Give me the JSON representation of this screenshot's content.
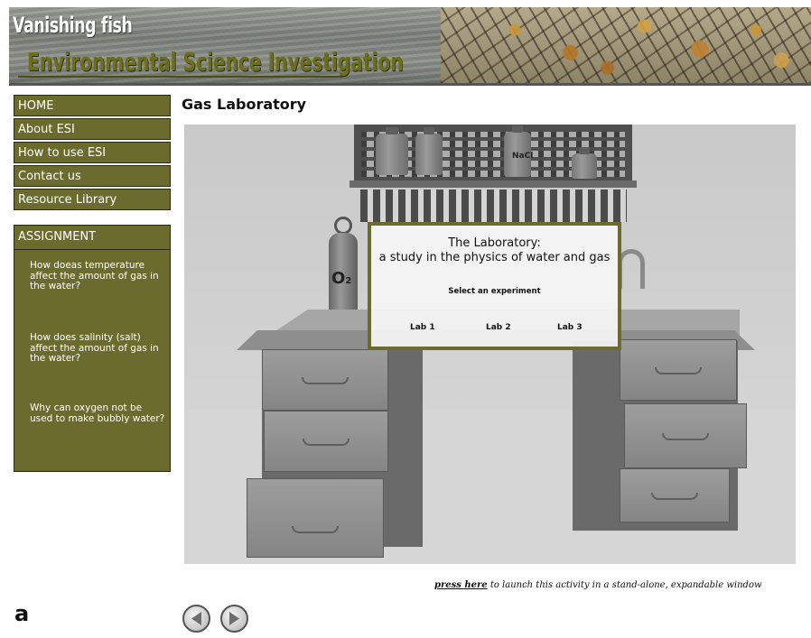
{
  "banner": {
    "line1": "Vanishing fish",
    "line2": "Environmental Science Investigation"
  },
  "nav": {
    "items": [
      "HOME",
      "About ESI",
      "How to use ESI",
      "Contact us",
      "Resource Library"
    ]
  },
  "assignment": {
    "heading": "ASSIGNMENT",
    "questions": [
      "How doeas temperature affect the amount of gas in the water?",
      "How does salinity (salt) affect the amount of gas in the water?",
      "Why can oxygen not be used to make bubbly water?"
    ]
  },
  "page_title": "Gas Laboratory",
  "lab_scene": {
    "bottle_label": "NaCl",
    "cylinder_label": "O",
    "cylinder_sub": "2"
  },
  "dialog": {
    "title_line1": "The Laboratory:",
    "title_line2": "a study in the physics of water and gas",
    "subtitle": "Select an experiment",
    "labs": [
      "Lab 1",
      "Lab 2",
      "Lab 3"
    ]
  },
  "launch": {
    "link_text": "press here",
    "rest_text": " to launch this activity in a stand-alone, expandable window"
  },
  "figure_label": "a",
  "navigation_arrows": [
    "previous-arrow-icon",
    "next-arrow-icon"
  ]
}
